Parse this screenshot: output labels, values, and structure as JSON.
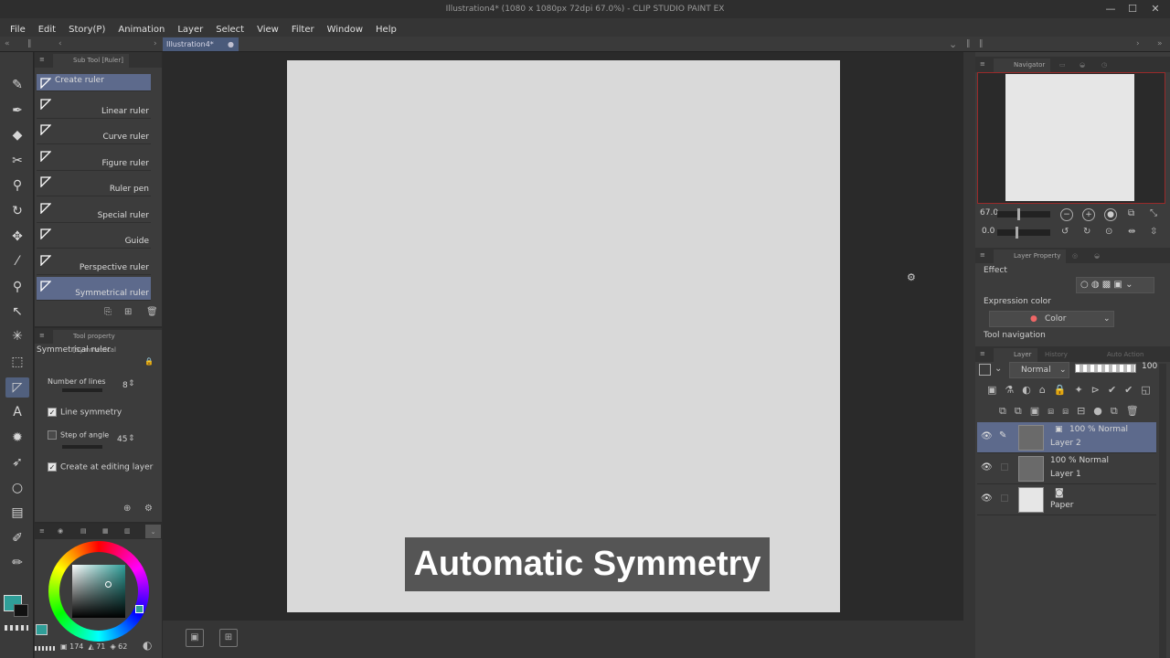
{
  "window": {
    "title": "Illustration4* (1080 x 1080px 72dpi 67.0%)  - CLIP STUDIO PAINT EX",
    "minimize": "—",
    "maximize": "☐",
    "close": "✕"
  },
  "menu": [
    "File",
    "Edit",
    "Story(P)",
    "Animation",
    "Layer",
    "Select",
    "View",
    "Filter",
    "Window",
    "Help"
  ],
  "document_tab": {
    "label": "Illustration4*"
  },
  "subtool_panel": {
    "title": "Sub Tool [Ruler]",
    "items": [
      "Create ruler",
      "Linear ruler",
      "Curve ruler",
      "Figure ruler",
      "Ruler pen",
      "Special ruler",
      "Guide",
      "Perspective ruler",
      "Symmetrical ruler"
    ]
  },
  "tool_property": {
    "title": "Tool property [Symmetrical",
    "name": "Symmetrical ruler",
    "number_of_lines_label": "Number of lines",
    "number_of_lines_value": "8",
    "line_symmetry_label": "Line symmetry",
    "line_symmetry_checked": true,
    "step_of_angle_label": "Step of angle",
    "step_of_angle_value": "45",
    "step_of_angle_checked": false,
    "create_at_editing_layer_label": "Create at editing layer",
    "create_at_editing_layer_checked": true
  },
  "color_panel": {
    "main_color": "#2f9e98",
    "sub_color": "#111111",
    "values": [
      "174",
      "71",
      "62"
    ]
  },
  "caption": "Automatic Symmetry",
  "navigator": {
    "title": "Navigator",
    "zoom": "67.0",
    "rotation": "0.0"
  },
  "layer_property": {
    "title": "Layer Property",
    "effect_label": "Effect",
    "expression_color_label": "Expression color",
    "expression_color_value": "Color",
    "tool_navigation_label": "Tool navigation"
  },
  "layer_panel": {
    "title": "Layer",
    "tab_history": "History",
    "tab_auto_action": "Auto Action",
    "blend_mode": "Normal",
    "opacity": "100",
    "layers": [
      {
        "mode": "100 % Normal",
        "name": "Layer 2"
      },
      {
        "mode": "100 % Normal",
        "name": "Layer 1"
      },
      {
        "mode": "",
        "name": "Paper"
      }
    ]
  }
}
